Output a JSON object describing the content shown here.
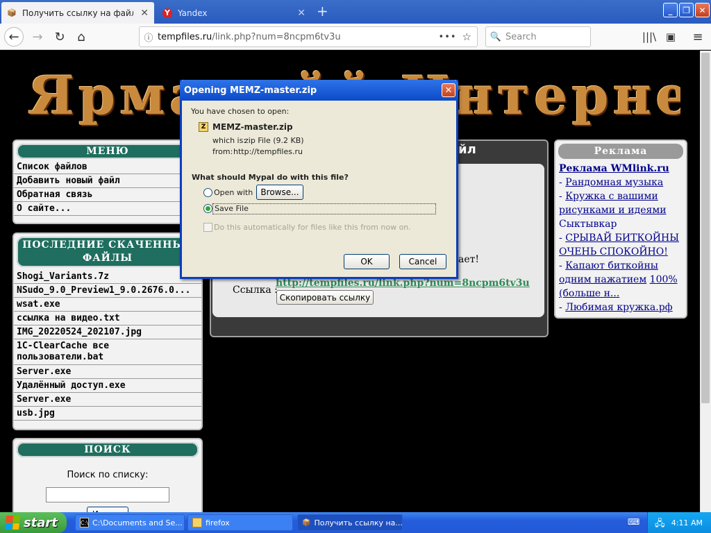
{
  "browser": {
    "tabs": [
      {
        "title": "Получить ссылку на файл - Temp"
      },
      {
        "title": "Yandex",
        "favicon_letter": "Y"
      }
    ],
    "url": {
      "host": "tempfiles.ru",
      "path": "/link.php?num=8ncpm6tv3u"
    },
    "search_placeholder": "Search"
  },
  "page": {
    "banner_text": "Ярмаркйй Интернет",
    "menu": {
      "title": "МЕНЮ",
      "items": [
        "Список файлов",
        "Добавить новый файл",
        "Обратная связь",
        "О сайте..."
      ]
    },
    "recent": {
      "title_line1": "ПОСЛЕДНИЕ СКАЧЕННЫЕ",
      "title_line2": "ФАЙЛЫ",
      "items": [
        "Shogi_Variants.7z",
        "NSudo_9.0_Preview1_9.0.2676.0...",
        "wsat.exe",
        "ссылка на видео.txt",
        "IMG_20220524_202107.jpg",
        "1C-ClearCache все пользователи.bat",
        "Server.exe",
        "Удалённый доступ.exe",
        "Server.exe",
        "usb.jpg"
      ]
    },
    "search": {
      "title": "ПОИСК",
      "label": "Поиск по списку:",
      "button": "Искать"
    },
    "center": {
      "title_fragment": "йл",
      "text_fragment": "ает!",
      "link_label": "Ссылка :",
      "link_url": "http://tempfiles.ru/link.php?num=8ncpm6tv3u",
      "copy_button": "Скопировать ссылку"
    },
    "ads": {
      "title": "Реклама",
      "header_link": "Реклама WMlink.ru",
      "items": [
        {
          "text": "Рандомная музыка"
        },
        {
          "text": "Кружка с вашими рисунками и идеями",
          "suffix": "Сыктывкар"
        },
        {
          "text": "СРЫВАЙ БИТКОЙНЫ ОЧЕНЬ СПОКОЙНО!"
        },
        {
          "text": "Капают биткойны одним нажатием",
          "suffix": "100%(больше н..."
        },
        {
          "text": "Любимая кружка.рф"
        }
      ]
    }
  },
  "dialog": {
    "title": "Opening MEMZ-master.zip",
    "chosen_text": "You have chosen to open:",
    "filename": "MEMZ-master.zip",
    "which_label": "which is:",
    "which_value": "zip File (9.2 KB)",
    "from_label": "from:",
    "from_value": "http://tempfiles.ru",
    "question": "What should Mypal do with this file?",
    "open_with_label": "Open with",
    "browse_button": "Browse...",
    "save_file_label": "Save File",
    "auto_label": "Do this automatically for files like this from now on.",
    "ok_button": "OK",
    "cancel_button": "Cancel",
    "selected": "save"
  },
  "taskbar": {
    "start_label": "start",
    "tasks": [
      {
        "label": "C:\\Documents and Se..."
      },
      {
        "label": "firefox"
      },
      {
        "label": "Получить ссылку на..."
      }
    ],
    "clock": "4:11 AM"
  }
}
